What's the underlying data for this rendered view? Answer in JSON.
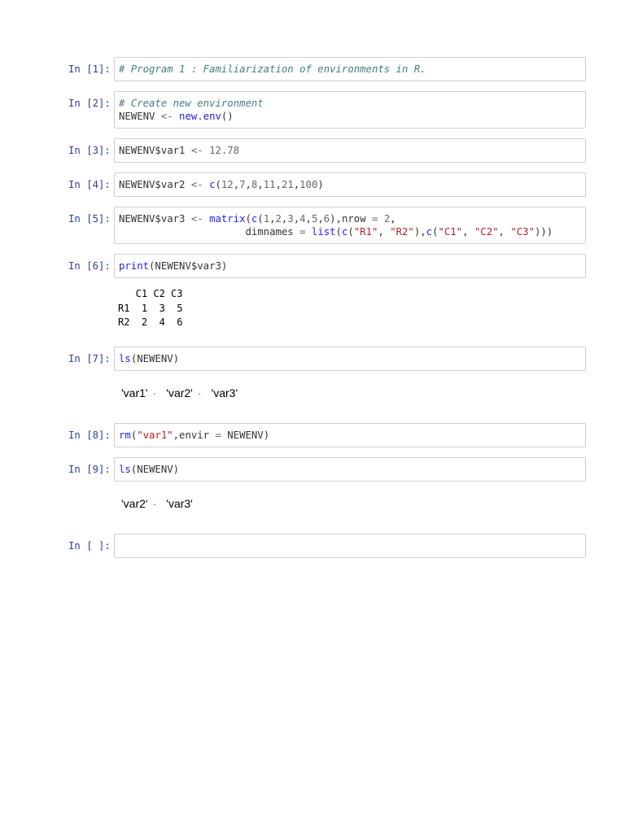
{
  "cells": [
    {
      "prompt": "In [1]:",
      "lines": [
        [
          [
            "c",
            "# Program 1 : Familiarization of environments in R."
          ]
        ]
      ]
    },
    {
      "prompt": "In [2]:",
      "lines": [
        [
          [
            "c",
            "# Create new environment"
          ]
        ],
        [
          [
            "p",
            "NEWENV "
          ],
          [
            "o",
            "<-"
          ],
          [
            "p",
            " "
          ],
          [
            "k",
            "new.env"
          ],
          [
            "p",
            "()"
          ]
        ]
      ]
    },
    {
      "prompt": "In [3]:",
      "lines": [
        [
          [
            "p",
            "NEWENV$var1 "
          ],
          [
            "o",
            "<-"
          ],
          [
            "p",
            " "
          ],
          [
            "n",
            "12.78"
          ]
        ]
      ]
    },
    {
      "prompt": "In [4]:",
      "lines": [
        [
          [
            "p",
            "NEWENV$var2 "
          ],
          [
            "o",
            "<-"
          ],
          [
            "p",
            " "
          ],
          [
            "k",
            "c"
          ],
          [
            "p",
            "("
          ],
          [
            "n",
            "12"
          ],
          [
            "p",
            ","
          ],
          [
            "n",
            "7"
          ],
          [
            "p",
            ","
          ],
          [
            "n",
            "8"
          ],
          [
            "p",
            ","
          ],
          [
            "n",
            "11"
          ],
          [
            "p",
            ","
          ],
          [
            "n",
            "21"
          ],
          [
            "p",
            ","
          ],
          [
            "n",
            "100"
          ],
          [
            "p",
            ")"
          ]
        ]
      ]
    },
    {
      "prompt": "In [5]:",
      "lines": [
        [
          [
            "p",
            "NEWENV$var3 "
          ],
          [
            "o",
            "<-"
          ],
          [
            "p",
            " "
          ],
          [
            "k",
            "matrix"
          ],
          [
            "p",
            "("
          ],
          [
            "k",
            "c"
          ],
          [
            "p",
            "("
          ],
          [
            "n",
            "1"
          ],
          [
            "p",
            ","
          ],
          [
            "n",
            "2"
          ],
          [
            "p",
            ","
          ],
          [
            "n",
            "3"
          ],
          [
            "p",
            ","
          ],
          [
            "n",
            "4"
          ],
          [
            "p",
            ","
          ],
          [
            "n",
            "5"
          ],
          [
            "p",
            ","
          ],
          [
            "n",
            "6"
          ],
          [
            "p",
            "),nrow "
          ],
          [
            "o",
            "="
          ],
          [
            "p",
            " "
          ],
          [
            "n",
            "2"
          ],
          [
            "p",
            ","
          ]
        ],
        [
          [
            "p",
            "                     dimnames "
          ],
          [
            "o",
            "="
          ],
          [
            "p",
            " "
          ],
          [
            "k",
            "list"
          ],
          [
            "p",
            "("
          ],
          [
            "k",
            "c"
          ],
          [
            "p",
            "("
          ],
          [
            "s",
            "\"R1\""
          ],
          [
            "p",
            ", "
          ],
          [
            "s",
            "\"R2\""
          ],
          [
            "p",
            "),"
          ],
          [
            "k",
            "c"
          ],
          [
            "p",
            "("
          ],
          [
            "s",
            "\"C1\""
          ],
          [
            "p",
            ", "
          ],
          [
            "s",
            "\"C2\""
          ],
          [
            "p",
            ", "
          ],
          [
            "s",
            "\"C3\""
          ],
          [
            "p",
            ")))"
          ]
        ]
      ]
    },
    {
      "prompt": "In [6]:",
      "lines": [
        [
          [
            "k",
            "print"
          ],
          [
            "p",
            "(NEWENV$var3)"
          ]
        ]
      ],
      "output_text": "   C1 C2 C3\nR1  1  3  5\nR2  2  4  6"
    },
    {
      "prompt": "In [7]:",
      "lines": [
        [
          [
            "k",
            "ls"
          ],
          [
            "p",
            "(NEWENV)"
          ]
        ]
      ],
      "output_list": [
        "'var1'",
        "'var2'",
        "'var3'"
      ]
    },
    {
      "prompt": "In [8]:",
      "lines": [
        [
          [
            "k",
            "rm"
          ],
          [
            "p",
            "("
          ],
          [
            "s",
            "\"var1\""
          ],
          [
            "p",
            ",envir "
          ],
          [
            "o",
            "="
          ],
          [
            "p",
            " NEWENV)"
          ]
        ]
      ]
    },
    {
      "prompt": "In [9]:",
      "lines": [
        [
          [
            "k",
            "ls"
          ],
          [
            "p",
            "(NEWENV)"
          ]
        ]
      ],
      "output_list": [
        "'var2'",
        "'var3'"
      ]
    },
    {
      "prompt": "In [ ]:",
      "lines": []
    }
  ],
  "list_separator": "·"
}
